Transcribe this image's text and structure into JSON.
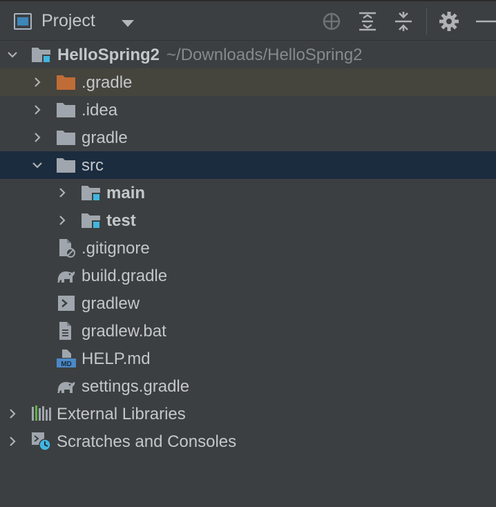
{
  "toolbar": {
    "title": "Project",
    "view_icon": "project-view-icon",
    "dropdown_icon": "chevron-down-icon",
    "buttons": [
      "locate-icon",
      "expand-all-icon",
      "collapse-all-icon",
      "gear-icon",
      "minimize-icon"
    ]
  },
  "tree": {
    "root": {
      "name": "HelloSpring2",
      "path": "~/Downloads/HelloSpring2",
      "expanded": true
    },
    "items": [
      {
        "label": ".gradle",
        "icon": "folder-excluded-icon",
        "collapsed": true
      },
      {
        "label": ".idea",
        "icon": "folder-icon",
        "collapsed": true
      },
      {
        "label": "gradle",
        "icon": "folder-icon",
        "collapsed": true
      },
      {
        "label": "src",
        "icon": "folder-icon",
        "expanded": true,
        "selected": true
      },
      {
        "label": "main",
        "icon": "module-folder-icon",
        "collapsed": true
      },
      {
        "label": "test",
        "icon": "module-folder-icon",
        "collapsed": true
      },
      {
        "label": ".gitignore",
        "icon": "ignored-file-icon"
      },
      {
        "label": "build.gradle",
        "icon": "gradle-elephant-icon"
      },
      {
        "label": "gradlew",
        "icon": "shell-script-icon"
      },
      {
        "label": "gradlew.bat",
        "icon": "text-file-icon"
      },
      {
        "label": "HELP.md",
        "icon": "markdown-file-icon"
      },
      {
        "label": "settings.gradle",
        "icon": "gradle-elephant-icon"
      }
    ],
    "external_libraries": {
      "label": "External Libraries",
      "icon": "libraries-icon"
    },
    "scratches": {
      "label": "Scratches and Consoles",
      "icon": "scratches-icon"
    }
  },
  "colors": {
    "background": "#3c3f41",
    "text": "#c4c7ca",
    "path_text": "#858a8f",
    "selected_row": "#1b2c3f",
    "excluded_row": "#45443d",
    "folder": "#a0a6ad",
    "excluded_folder": "#c06c36",
    "module_badge": "#40b6e0"
  }
}
